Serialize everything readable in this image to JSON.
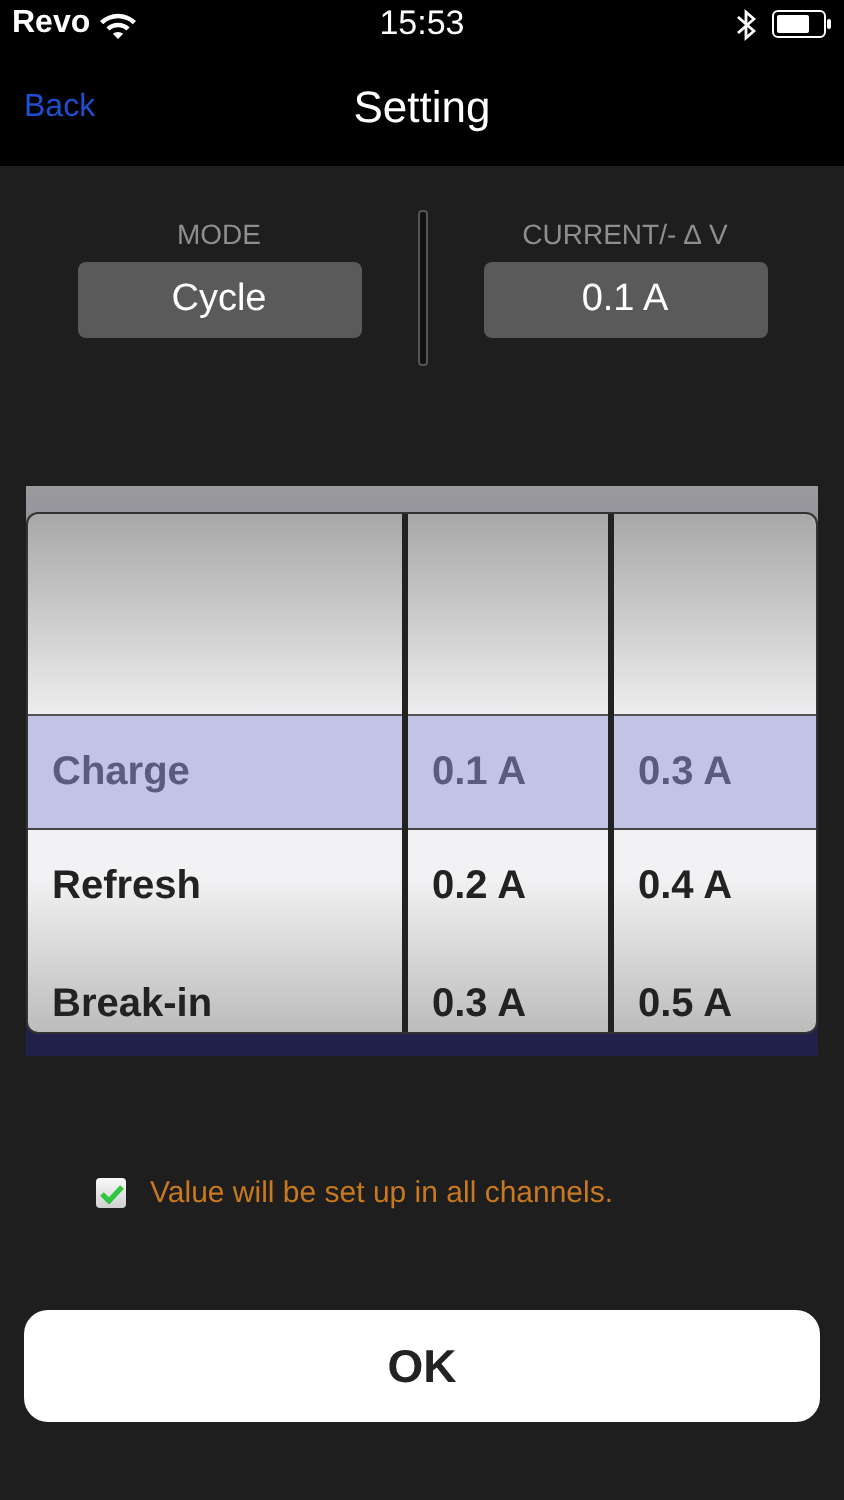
{
  "status_bar": {
    "carrier": "Revo",
    "time": "15:53"
  },
  "nav": {
    "back": "Back",
    "title": "Setting"
  },
  "settings": [
    {
      "label": "MODE",
      "value": "Cycle"
    },
    {
      "label": "CURRENT/- ∆ V",
      "value": "0.1 A"
    }
  ],
  "picker": {
    "columns": [
      {
        "rows": [
          {
            "label": "Charge",
            "selected": true
          },
          {
            "label": "Refresh",
            "selected": false
          },
          {
            "label": "Break-in",
            "selected": false
          }
        ]
      },
      {
        "rows": [
          {
            "label": "0.1 A",
            "selected": true
          },
          {
            "label": "0.2 A",
            "selected": false
          },
          {
            "label": "0.3 A",
            "selected": false
          }
        ]
      },
      {
        "rows": [
          {
            "label": "0.3 A",
            "selected": true
          },
          {
            "label": "0.4 A",
            "selected": false
          },
          {
            "label": "0.5 A",
            "selected": false
          }
        ]
      }
    ]
  },
  "apply_all": {
    "label": "Value will be set up in all channels.",
    "checked": true
  },
  "ok_button": "OK"
}
